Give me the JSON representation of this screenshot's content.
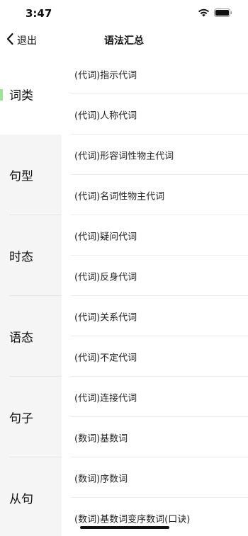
{
  "status_bar": {
    "time": "3:47"
  },
  "nav": {
    "back_label": "退出",
    "title": "语法汇总"
  },
  "sidebar": {
    "categories": [
      {
        "label": "词类",
        "selected": true
      },
      {
        "label": "句型",
        "selected": false
      },
      {
        "label": "时态",
        "selected": false
      },
      {
        "label": "语态",
        "selected": false
      },
      {
        "label": "句子",
        "selected": false
      },
      {
        "label": "从句",
        "selected": false
      }
    ],
    "indicator_color": "#9fe09a"
  },
  "content": {
    "items": [
      "(代词)指示代词",
      "(代词)人称代词",
      "(代词)形容词性物主代词",
      "(代词)名词性物主代词",
      "(代词)疑问代词",
      "(代词)反身代词",
      "(代词)关系代词",
      "(代词)不定代词",
      "(代词)连接代词",
      "(数词)基数词",
      "(数词)序数词",
      "(数词)基数词变序数词(口诀)"
    ]
  }
}
